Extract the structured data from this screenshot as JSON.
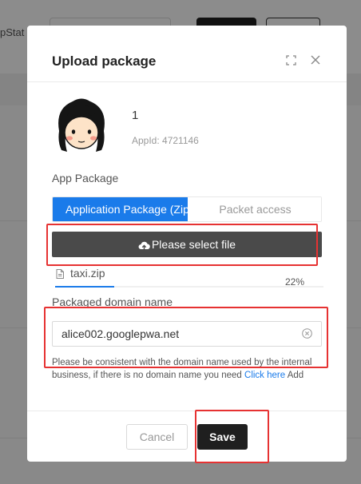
{
  "background": {
    "status_text": "pStat"
  },
  "modal": {
    "title": "Upload package",
    "app": {
      "name": "1",
      "id_label": "AppId: 4721146"
    },
    "package": {
      "label": "App Package",
      "tabs": [
        {
          "label": "Application Package (Zip)",
          "active": true
        },
        {
          "label": "Packet access",
          "active": false
        }
      ],
      "select_button": "Please select file",
      "file": {
        "name": "taxi.zip",
        "progress_text": "22%",
        "progress": 22
      }
    },
    "domain": {
      "label": "Packaged domain name",
      "value": "alice002.googlepwa.net",
      "hint_before": "Please be consistent with the domain name used by the internal business, if there is no domain name you need",
      "hint_link": "Click here",
      "hint_after": "Add"
    },
    "footer": {
      "cancel_label": "Cancel",
      "save_label": "Save"
    }
  },
  "colors": {
    "accent": "#1a7bea",
    "dark_button": "#1f1f1f",
    "select_button": "#4a4a4a",
    "highlight": "#e63232"
  }
}
